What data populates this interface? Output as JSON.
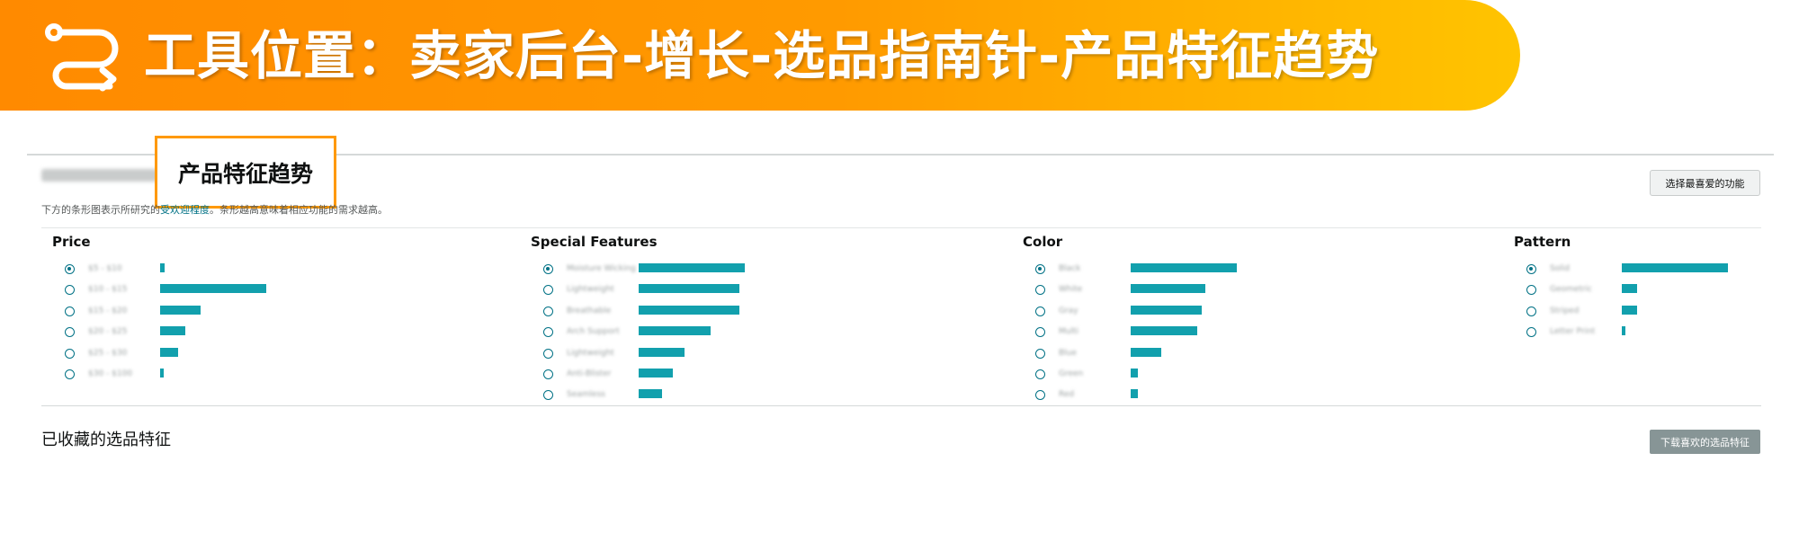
{
  "banner": {
    "title": "工具位置：卖家后台-增长-选品指南针-产品特征趋势",
    "icon": "loop-arrow-icon",
    "gradient_start": "#ff8a00",
    "gradient_end": "#ffc400"
  },
  "panel": {
    "callout_title": "产品特征趋势",
    "select_button": "选择最喜爱的功能",
    "description_prefix": "下方的条形图表示所研究的",
    "description_link": "受欢迎程度",
    "description_suffix": "。条形越高意味着相应功能的需求越高。",
    "accent_color": "#12a0ad"
  },
  "features": [
    {
      "title": "Price",
      "rows": [
        {
          "label": "$5 - $10",
          "value": 0.04,
          "checked": true
        },
        {
          "label": "$10 - $15",
          "value": 1.0,
          "checked": false
        },
        {
          "label": "$15 - $20",
          "value": 0.38,
          "checked": false
        },
        {
          "label": "$20 - $25",
          "value": 0.24,
          "checked": false
        },
        {
          "label": "$25 - $30",
          "value": 0.17,
          "checked": false
        },
        {
          "label": "$30 - $100",
          "value": 0.03,
          "checked": false
        }
      ]
    },
    {
      "title": "Special Features",
      "rows": [
        {
          "label": "Moisture Wicking",
          "value": 1.0,
          "checked": true
        },
        {
          "label": "Lightweight",
          "value": 0.95,
          "checked": false
        },
        {
          "label": "Breathable",
          "value": 0.95,
          "checked": false
        },
        {
          "label": "Arch Support",
          "value": 0.68,
          "checked": false
        },
        {
          "label": "Lightweight",
          "value": 0.43,
          "checked": false
        },
        {
          "label": "Anti-Blister",
          "value": 0.32,
          "checked": false
        },
        {
          "label": "Seamless",
          "value": 0.22,
          "checked": false
        }
      ]
    },
    {
      "title": "Color",
      "rows": [
        {
          "label": "Black",
          "value": 1.0,
          "checked": true
        },
        {
          "label": "White",
          "value": 0.7,
          "checked": false
        },
        {
          "label": "Gray",
          "value": 0.67,
          "checked": false
        },
        {
          "label": "Multi",
          "value": 0.63,
          "checked": false
        },
        {
          "label": "Blue",
          "value": 0.29,
          "checked": false
        },
        {
          "label": "Green",
          "value": 0.07,
          "checked": false
        },
        {
          "label": "Red",
          "value": 0.07,
          "checked": false
        }
      ]
    },
    {
      "title": "Pattern",
      "rows": [
        {
          "label": "Solid",
          "value": 1.0,
          "checked": true
        },
        {
          "label": "Geometric",
          "value": 0.14,
          "checked": false
        },
        {
          "label": "Striped",
          "value": 0.14,
          "checked": false
        },
        {
          "label": "Letter Print",
          "value": 0.02,
          "checked": false
        }
      ]
    }
  ],
  "saved": {
    "title": "已收藏的选品特征",
    "download_button": "下载喜欢的选品特征"
  }
}
